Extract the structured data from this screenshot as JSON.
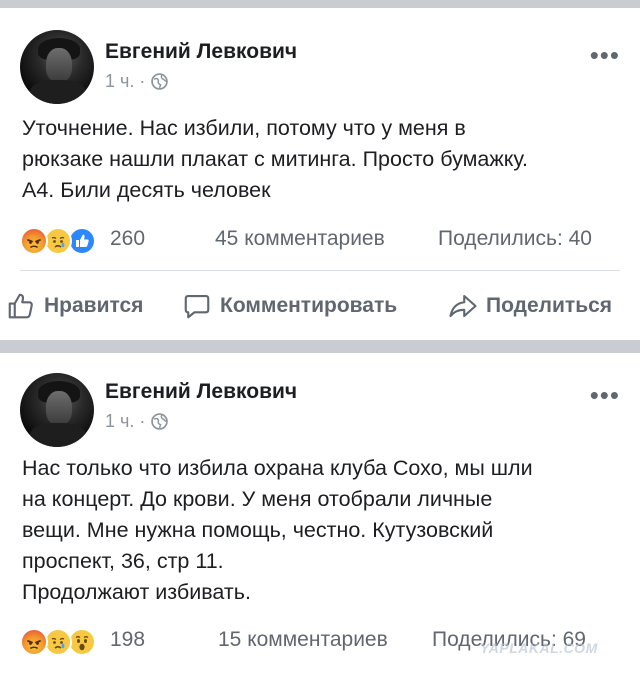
{
  "posts": [
    {
      "author": "Евгений Левкович",
      "time": "1 ч. ·",
      "text_lines": [
        "Уточнение. Нас избили, потому что у меня в",
        "рюкзаке нашли плакат с митинга. Просто бумажку.",
        "А4. Били десять человек"
      ],
      "reactions": [
        "angry",
        "sad",
        "like"
      ],
      "reaction_count": "260",
      "comments": "45 комментариев",
      "shares": "Поделились: 40",
      "actions": {
        "like": "Нравится",
        "comment": "Комментировать",
        "share": "Поделиться"
      }
    },
    {
      "author": "Евгений Левкович",
      "time": "1 ч. ·",
      "text_lines": [
        "Нас только что избила охрана клуба Сохо, мы шли",
        "на концерт. До крови. У меня отобрали личные",
        "вещи. Мне нужна помощь, честно. Кутузовский",
        "проспект, 36, стр 11.",
        "Продолжают избивать."
      ],
      "reactions": [
        "angry",
        "sad",
        "wow"
      ],
      "reaction_count": "198",
      "comments": "15 комментариев",
      "shares": "Поделились: 69"
    }
  ],
  "watermark": "YAPLAKAL.COM",
  "icons": {
    "more": "more-dots-icon",
    "privacy": "globe-icon",
    "like": "thumbs-up-icon",
    "comment": "comment-bubble-icon",
    "share": "share-arrow-icon"
  },
  "colors": {
    "text": "#1c1e21",
    "secondary": "#606770",
    "meta": "#8d949e",
    "like_blue": "#2d88ff",
    "background": "#c9ccd1"
  }
}
